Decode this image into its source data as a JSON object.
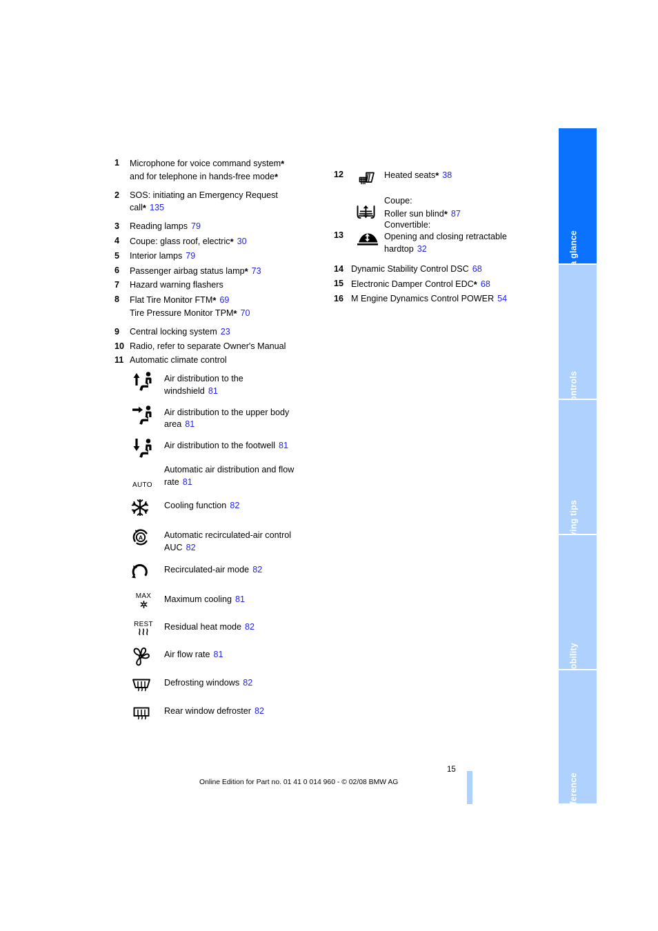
{
  "page": {
    "number": "15",
    "footer_text": "Online Edition for Part no. 01 41 0 014 960 - © 02/08 BMW AG",
    "accent_page_ref_color": "#2222ee",
    "tab_active_color": "#0a72fd",
    "tab_inactive_color": "#aed2fd",
    "page_bar_color": "#aed2fd"
  },
  "tabs": [
    {
      "label": "At a glance",
      "state": "active"
    },
    {
      "label": "Controls",
      "state": "inactive"
    },
    {
      "label": "Driving tips",
      "state": "inactive"
    },
    {
      "label": "Mobility",
      "state": "inactive"
    },
    {
      "label": "Reference",
      "state": "inactive"
    }
  ],
  "left_column": {
    "items": [
      {
        "number": "1",
        "line1": "Microphone for voice command system",
        "line1_star": "*",
        "line2": "and for telephone in hands-free mode",
        "line2_star": "*",
        "page": ""
      },
      {
        "number": "2",
        "line1": "SOS: initiating an Emergency Request",
        "line1_star": "",
        "line2": "call",
        "line2_star": "*",
        "page": "135"
      },
      {
        "number": "3",
        "line1": "Reading lamps",
        "line1_star": "",
        "page": "79"
      },
      {
        "number": "4",
        "line1": "Coupe: glass roof, electric",
        "line1_star": "*",
        "page": "30"
      },
      {
        "number": "5",
        "line1": "Interior lamps",
        "line1_star": "",
        "page": "79"
      },
      {
        "number": "6",
        "line1": "Passenger airbag status lamp",
        "line1_star": "*",
        "page": "73"
      },
      {
        "number": "7",
        "line1": "Hazard warning flashers",
        "line1_star": "",
        "page": ""
      },
      {
        "number": "8",
        "line1": "Flat Tire Monitor FTM",
        "line1_star": "*",
        "line1_page": "69",
        "line2": "Tire Pressure Monitor TPM",
        "line2_star": "*",
        "page": "70"
      },
      {
        "number": "9",
        "line1": "Central locking system",
        "line1_star": "",
        "page": "23"
      },
      {
        "number": "10",
        "line1": "Radio, refer to separate Owner's Manual",
        "line1_star": "",
        "page": ""
      },
      {
        "number": "11",
        "line1": "Automatic climate control",
        "line1_star": "",
        "page": ""
      }
    ]
  },
  "climate_icons": [
    {
      "icon": "air-distribution-windshield-icon",
      "line1": "Air distribution to the",
      "line2": "windshield",
      "page": "81"
    },
    {
      "icon": "air-distribution-upper-body-icon",
      "line1": "Air distribution to the upper body",
      "line2": "area",
      "page": "81"
    },
    {
      "icon": "air-distribution-footwell-icon",
      "line1": "Air distribution to the footwell",
      "line2": "",
      "page": "81"
    },
    {
      "icon": "auto-text-icon",
      "icon_text": "AUTO",
      "line1": "Automatic air distribution and flow",
      "line2": "rate",
      "page": "81"
    },
    {
      "icon": "snowflake-icon",
      "line1": "Cooling function",
      "line2": "",
      "page": "82"
    },
    {
      "icon": "auc-recirculation-auto-icon",
      "line1": "Automatic recirculated-air control",
      "line2": "AUC",
      "page": "82"
    },
    {
      "icon": "recirculated-air-icon",
      "line1": "Recirculated-air mode",
      "line2": "",
      "page": "82"
    },
    {
      "icon": "max-cooling-icon",
      "icon_text": "MAX",
      "line1": "Maximum cooling",
      "line2": "",
      "page": "81"
    },
    {
      "icon": "rest-heat-icon",
      "icon_text": "REST",
      "line1": "Residual heat mode",
      "line2": "",
      "page": "82"
    },
    {
      "icon": "fan-blower-icon",
      "line1": "Air flow rate",
      "line2": "",
      "page": "81"
    },
    {
      "icon": "defrost-windshield-icon",
      "line1": "Defrosting windows",
      "line2": "",
      "page": "82"
    },
    {
      "icon": "rear-window-defroster-icon",
      "line1": "Rear window defroster",
      "line2": "",
      "page": "82"
    }
  ],
  "right_column": {
    "icon_items": [
      {
        "number": "12",
        "icon": "heated-seat-icon",
        "line1": "Heated seats",
        "line1_star": "*",
        "page": "38"
      },
      {
        "number": "13",
        "icon_a": "roller-sun-blind-icon",
        "icon_b": "retractable-hardtop-icon",
        "coupe_label": "Coupe:",
        "coupe_line": "Roller sun blind",
        "coupe_star": "*",
        "coupe_page": "87",
        "conv_label": "Convertible:",
        "conv_line1": "Opening and closing retractable",
        "conv_line2": "hardtop",
        "conv_page": "32"
      }
    ],
    "items": [
      {
        "number": "14",
        "line1": "Dynamic Stability Control DSC",
        "line1_star": "",
        "page": "68"
      },
      {
        "number": "15",
        "line1": "Electronic Damper Control EDC",
        "line1_star": "*",
        "page": "68"
      },
      {
        "number": "16",
        "line1": "M Engine Dynamics Control POWER",
        "line1_star": "",
        "page": "54"
      }
    ]
  }
}
